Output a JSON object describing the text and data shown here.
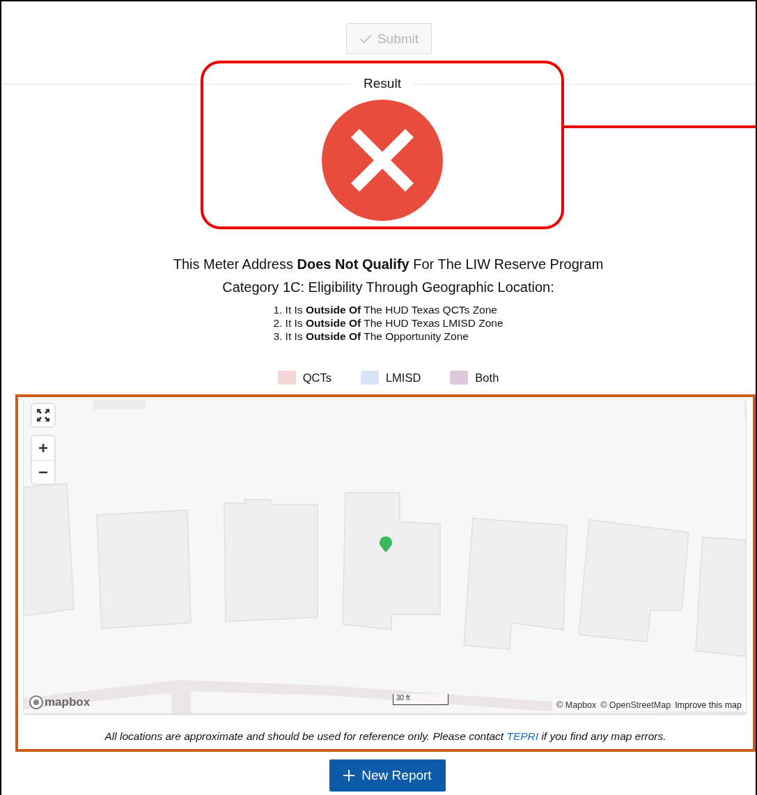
{
  "submit_button": {
    "label": "Submit",
    "disabled": true
  },
  "result": {
    "legend": "Result",
    "passed": false
  },
  "message": {
    "headline": "This Meter Address **Does Not Qualify** For The LIW Reserve Program",
    "category": "Category 1C: Eligibility Through Geographic Location:",
    "reasons": [
      "1. It Is **Outside Of** The HUD Texas QCTs Zone",
      "2. It Is **Outside Of** The HUD Texas LMISD Zone",
      "3. It Is **Outside Of** The Opportunity Zone"
    ]
  },
  "legend": [
    {
      "label": "QCTs",
      "color": "#f5d6d9"
    },
    {
      "label": "LMISD",
      "color": "#d9e3f6"
    },
    {
      "label": "Both",
      "color": "#dcc9dc"
    }
  ],
  "map": {
    "logo": "mapbox",
    "scale": "30 ft",
    "attribution": [
      "© Mapbox",
      "© OpenStreetMap",
      "Improve this map"
    ],
    "note": {
      "before": "All locations are approximate and should be used for reference only. Please contact ",
      "link": "TEPRI",
      "after": " if you find any map errors."
    }
  },
  "new_report_button": {
    "label": "New Report"
  }
}
